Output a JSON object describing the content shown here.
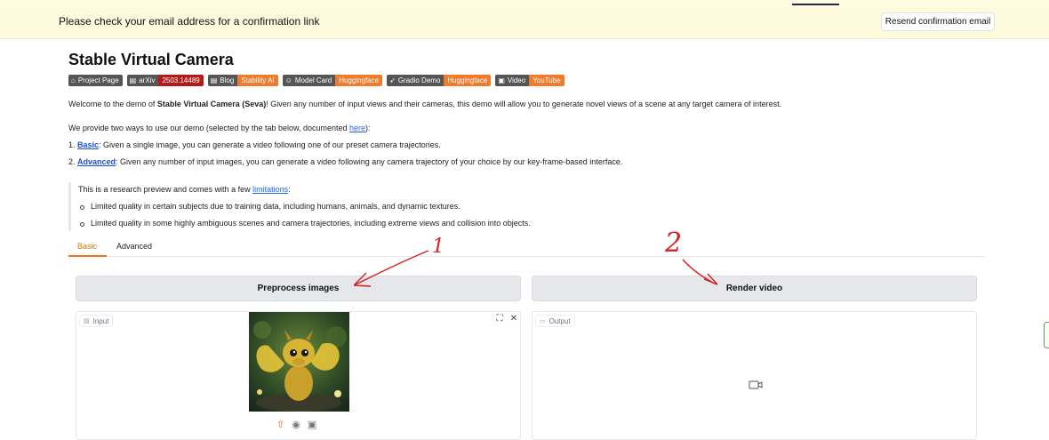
{
  "banner": {
    "message": "Please check your email address for a confirmation link",
    "resend_label": "Resend confirmation email"
  },
  "page": {
    "title": "Stable Virtual Camera"
  },
  "badges": [
    {
      "icon": "home-icon",
      "left": "Project Page",
      "right": "",
      "right_color": ""
    },
    {
      "icon": "document-icon",
      "left": "arXiv",
      "right": "2503.14489",
      "right_color": "#b31b1b"
    },
    {
      "icon": "document-icon",
      "left": "Blog",
      "right": "Stability AI",
      "right_color": "#ef7b2d"
    },
    {
      "icon": "smile-icon",
      "left": "Model Card",
      "right": "Huggingface",
      "right_color": "#ef7b2d"
    },
    {
      "icon": "rocket-icon",
      "left": "Gradio Demo",
      "right": "Huggingface",
      "right_color": "#ef7b2d"
    },
    {
      "icon": "film-icon",
      "left": "Video",
      "right": "YouTube",
      "right_color": "#ef7b2d"
    }
  ],
  "intro": {
    "p1_prefix": "Welcome to the demo of ",
    "p1_bold": "Stable Virtual Camera (Seva)",
    "p1_suffix": "! Given any number of input views and their cameras, this demo will allow you to generate novel views of a scene at any target camera of interest.",
    "p2_prefix": "We provide two ways to use our demo (selected by the tab below, documented ",
    "p2_link": "here",
    "p2_suffix": "):",
    "item1_num": "1. ",
    "item1_link": "Basic",
    "item1_text": ": Given a single image, you can generate a video following one of our preset camera trajectories.",
    "item2_num": "2. ",
    "item2_link": "Advanced",
    "item2_text": ": Given any number of input images, you can generate a video following any camera trajectory of your choice by our key-frame-based interface."
  },
  "note": {
    "prefix": "This is a research preview and comes with a few ",
    "link": "limitations",
    "suffix": ":",
    "bullets": [
      "Limited quality in certain subjects due to training data, including humans, animals, and dynamic textures.",
      "Limited quality in some highly ambiguous scenes and camera trajectories, including extreme views and collision into objects."
    ]
  },
  "tabs": {
    "basic": "Basic",
    "advanced": "Advanced",
    "active": "Basic"
  },
  "actions": {
    "preprocess": "Preprocess images",
    "render": "Render video"
  },
  "input_panel": {
    "label": "Input",
    "icon": "image-icon"
  },
  "output_panel": {
    "label": "Output",
    "icon": "video-icon"
  },
  "annotations": {
    "mark1": "1",
    "mark2": "2",
    "color": "#d42020"
  },
  "colors": {
    "accent": "#f97316",
    "link": "#2563eb",
    "banner_bg": "#fffbe0"
  }
}
